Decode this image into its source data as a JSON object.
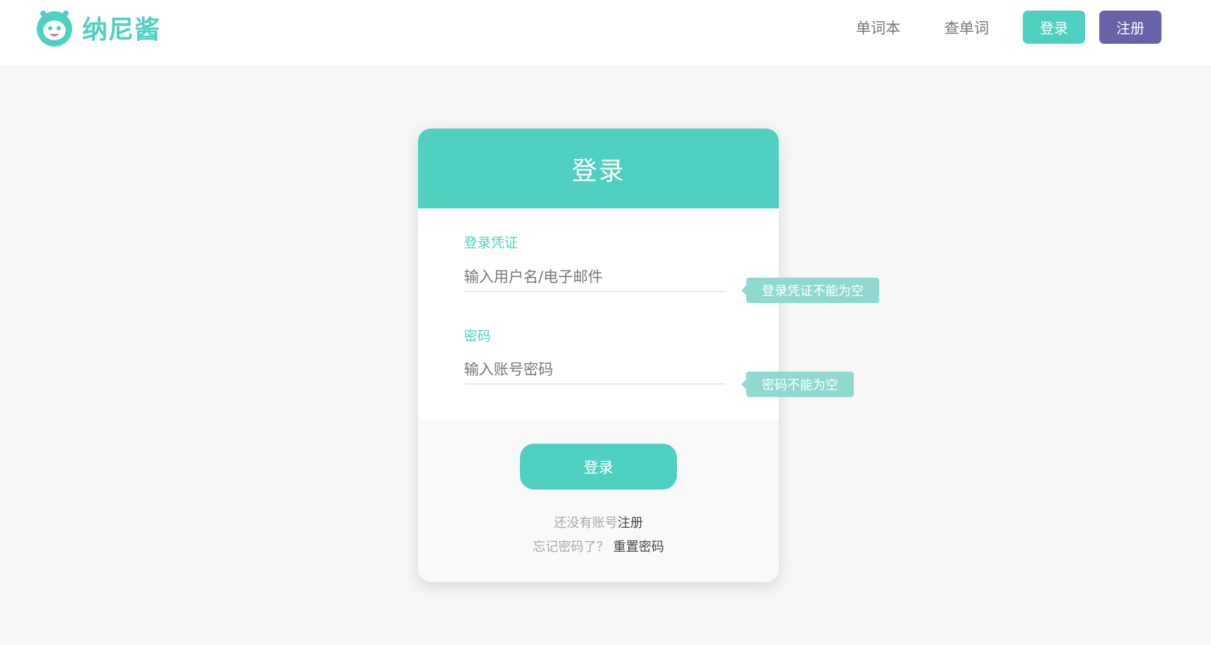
{
  "header": {
    "logo_text": "纳尼酱",
    "nav": {
      "wordbook": "单词本",
      "lookup": "查单词",
      "login": "登录",
      "register": "注册"
    }
  },
  "login_card": {
    "title": "登录",
    "credential": {
      "label": "登录凭证",
      "placeholder": "输入用户名/电子邮件",
      "value": "",
      "error": "登录凭证不能为空"
    },
    "password": {
      "label": "密码",
      "placeholder": "输入账号密码",
      "value": "",
      "error": "密码不能为空"
    },
    "submit_label": "登录",
    "no_account_text": "还没有账号",
    "register_link": "注册",
    "forgot_text": "忘记密码了？",
    "reset_link": "重置密码"
  },
  "colors": {
    "accent": "#4fd0c0",
    "secondary": "#6862a8",
    "tooltip": "#8fd9d1"
  }
}
